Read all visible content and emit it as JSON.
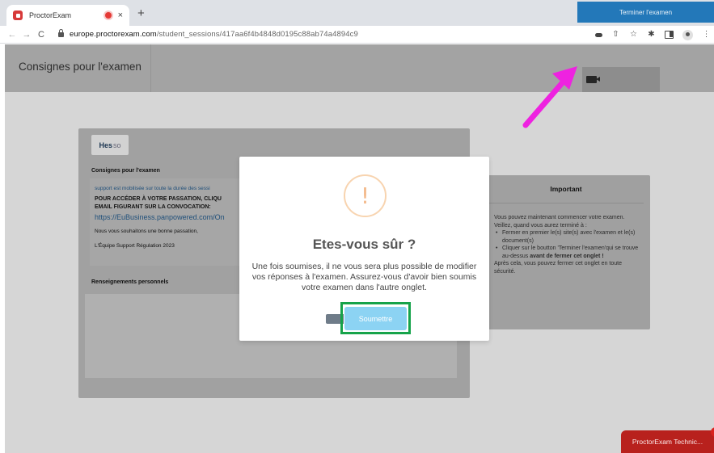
{
  "browser": {
    "tab_title": "ProctorExam",
    "tab_close": "×",
    "new_tab": "+",
    "chevron": "⌄",
    "back": "←",
    "forward": "→",
    "reload": "C",
    "url_domain": "europe.proctorexam.com",
    "url_path": "/student_sessions/417aa6f4b4848d0195c88ab74a4894c9",
    "toolbar_icons": [
      "key-icon",
      "share-icon",
      "star-icon",
      "extensions-icon",
      "sidepanel-icon",
      "profile-icon",
      "menu-icon"
    ],
    "star": "☆",
    "share": "⇧",
    "extensions": "✱",
    "menu": "⋮"
  },
  "header": {
    "title": "Consignes pour l'examen",
    "terminate_button": "Terminer l'examen"
  },
  "instructions": {
    "logo_text": "Hes",
    "logo_suffix": "so",
    "heading": "Consignes pour l'examen",
    "support_line": "support est mobilisée sur toute la durée des sessi",
    "access_text": "POUR ACCÉDER À VOTRE PASSATION, CLIQU\nEMAIL FIGURANT SUR LA CONVOCATION:",
    "link_text": "https://EuBusiness.panpowered.com/On",
    "wish_text": "Nous vous souhaitons une bonne passation,",
    "team_text": "L'Équipe Support Régulation 2023",
    "personal_heading": "Renseignements personnels"
  },
  "important": {
    "title": "Important",
    "intro": "Vous pouvez maintenant commencer votre examen. Veillez, quand vous aurez terminé à :",
    "bullet_1": "Fermer en premier le(s) site(s) avec l'examen et le(s) document(s)",
    "bullet_2_start": "Cliquer sur le boutton 'Terminer l'examen'qui se trouve au-dessus ",
    "bullet_2_bold": "avant de fermer cet onglet !",
    "after": "Après cela, vous pouvez fermer cet onglet en toute sécurité."
  },
  "modal": {
    "icon_glyph": "!",
    "title": "Etes-vous sûr ?",
    "message": "Une fois soumises, il ne vous sera plus possible de modifier vos réponses à l'examen. Assurez-vous d'avoir bien soumis votre examen dans l'autre onglet.",
    "submit_button": "Soumettre"
  },
  "support_chat": {
    "label": "ProctorExam Technic..."
  },
  "colors": {
    "terminate_button": "#2378b9",
    "submit_button": "#8cd3f3",
    "highlight_box": "#16a34a",
    "arrow": "#ee22e0",
    "support_chat": "#b8211d"
  }
}
